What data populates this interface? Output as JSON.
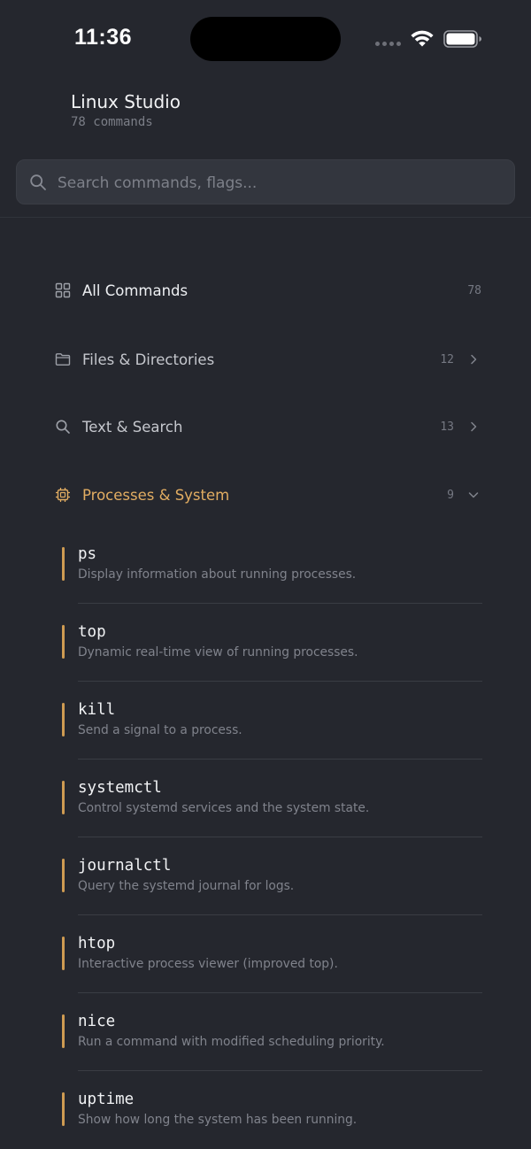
{
  "status_bar": {
    "time": "11:36"
  },
  "header": {
    "title": "Linux Studio",
    "subtitle": "78 commands"
  },
  "search": {
    "placeholder": "Search commands, flags..."
  },
  "categories": [
    {
      "label": "All Commands",
      "count": "78",
      "icon": "grid-icon",
      "state": "default"
    },
    {
      "label": "Files & Directories",
      "count": "12",
      "icon": "folder-icon",
      "state": "collapsed"
    },
    {
      "label": "Text & Search",
      "count": "13",
      "icon": "search-icon",
      "state": "collapsed"
    },
    {
      "label": "Processes & System",
      "count": "9",
      "icon": "cpu-icon",
      "state": "expanded"
    }
  ],
  "commands": [
    {
      "name": "ps",
      "description": "Display information about running processes."
    },
    {
      "name": "top",
      "description": "Dynamic real-time view of running processes."
    },
    {
      "name": "kill",
      "description": "Send a signal to a process."
    },
    {
      "name": "systemctl",
      "description": "Control systemd services and the system state."
    },
    {
      "name": "journalctl",
      "description": "Query the systemd journal for logs."
    },
    {
      "name": "htop",
      "description": "Interactive process viewer (improved top)."
    },
    {
      "name": "nice",
      "description": "Run a command with modified scheduling priority."
    },
    {
      "name": "uptime",
      "description": "Show how long the system has been running."
    }
  ],
  "colors": {
    "background": "#25272e",
    "accent": "#e2ad62",
    "search_bg": "#33363e"
  }
}
